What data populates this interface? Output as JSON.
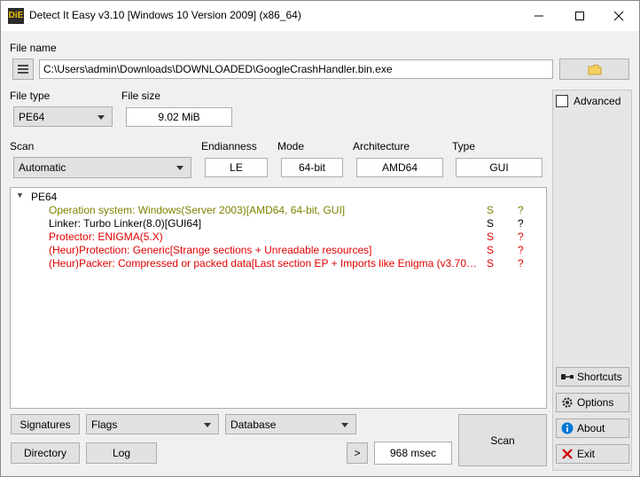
{
  "window": {
    "title": "Detect It Easy v3.10 [Windows 10 Version 2009] (x86_64)",
    "app_icon_text": "DiE"
  },
  "file_name": {
    "label": "File name",
    "path": "C:\\Users\\admin\\Downloads\\DOWNLOADED\\GoogleCrashHandler.bin.exe"
  },
  "file_type": {
    "label": "File type",
    "value": "PE64"
  },
  "file_size": {
    "label": "File size",
    "value": "9.02 MiB"
  },
  "scan": {
    "label": "Scan",
    "value": "Automatic"
  },
  "endianness": {
    "label": "Endianness",
    "value": "LE"
  },
  "mode": {
    "label": "Mode",
    "value": "64-bit"
  },
  "architecture": {
    "label": "Architecture",
    "value": "AMD64"
  },
  "type": {
    "label": "Type",
    "value": "GUI"
  },
  "advanced": {
    "label": "Advanced",
    "checked": false
  },
  "results": {
    "root": "PE64",
    "rows": [
      {
        "text": "Operation system: Windows(Server 2003)[AMD64, 64-bit, GUI]",
        "s": "S",
        "q": "?",
        "color": "#808000"
      },
      {
        "text": "Linker: Turbo Linker(8.0)[GUI64]",
        "s": "S",
        "q": "?",
        "color": "#000000"
      },
      {
        "text": "Protector: ENIGMA(5.X)",
        "s": "S",
        "q": "?",
        "color": "#e00000"
      },
      {
        "text": "(Heur)Protection: Generic[Strange sections + Unreadable resources]",
        "s": "S",
        "q": "?",
        "color": "#e00000"
      },
      {
        "text": "(Heur)Packer: Compressed or packed data[Last section EP + Imports like Enigma (v3.70+) ...",
        "s": "S",
        "q": "?",
        "color": "#e00000"
      }
    ]
  },
  "bottom": {
    "signatures": "Signatures",
    "flags": "Flags",
    "database": "Database",
    "directory": "Directory",
    "log": "Log",
    "more": ">",
    "time": "968 msec",
    "scan": "Scan"
  },
  "side": {
    "shortcuts": "Shortcuts",
    "options": "Options",
    "about": "About",
    "exit": "Exit"
  },
  "colors": {
    "warning": "#808000",
    "danger": "#e00000",
    "accent": "#0078d7"
  }
}
